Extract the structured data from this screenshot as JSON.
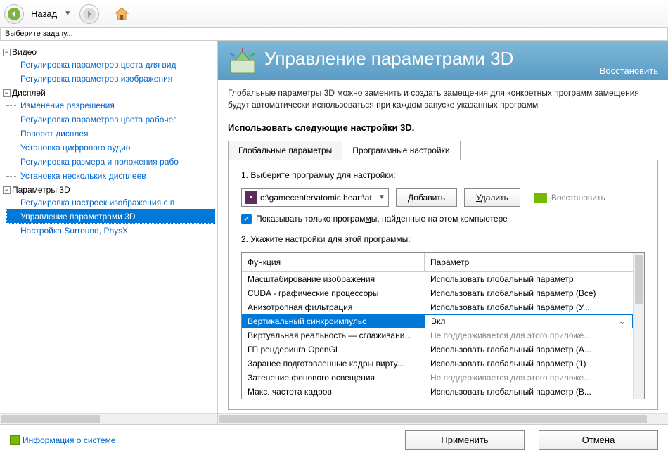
{
  "toolbar": {
    "back_label": "Назад"
  },
  "task_prompt": "Выберите задачу...",
  "tree": [
    {
      "title": "Видео",
      "items": [
        "Регулировка параметров цвета для вид",
        "Регулировка параметров изображения "
      ]
    },
    {
      "title": "Дисплей",
      "items": [
        "Изменение разрешения",
        "Регулировка параметров цвета рабочег",
        "Поворот дисплея",
        "Установка цифрового аудио",
        "Регулировка размера и положения рабо",
        "Установка нескольких дисплеев"
      ]
    },
    {
      "title": "Параметры 3D",
      "items": [
        "Регулировка настроек изображения с п",
        "Управление параметрами 3D",
        "Настройка Surround, PhysX"
      ]
    }
  ],
  "selected_item": "Управление параметрами 3D",
  "banner": {
    "title": "Управление параметрами 3D",
    "restore": "Восстановить"
  },
  "description": "Глобальные параметры 3D можно заменить и создать замещения для конкретных программ замещения будут автоматически использоваться при каждом запуске указанных программ",
  "section_title": "Использовать следующие настройки 3D.",
  "tabs": {
    "global": "Глобальные параметры",
    "program": "Программные настройки"
  },
  "program_tab": {
    "step1_label": "1. Выберите программу для настройки:",
    "selected_program": "c:\\gamecenter\\atomic heart\\at...",
    "add_btn": "Добавить",
    "remove_btn": "Удалить",
    "restore_btn": "Восстановить",
    "show_only_found_prefix": "Показывать только програм",
    "show_only_found_accel": "м",
    "show_only_found_suffix": "ы, найденные на этом компьютере",
    "step2_label": "2. Укажите настройки для этой программы:",
    "col_function": "Функция",
    "col_param": "Параметр",
    "rows": [
      {
        "f": "Масштабирование изображения",
        "p": "Использовать глобальный параметр",
        "gray": false
      },
      {
        "f": "CUDA - графические процессоры",
        "p": "Использовать глобальный параметр (Все)",
        "gray": false
      },
      {
        "f": "Анизотропная фильтрация",
        "p": "Использовать глобальный параметр (У...",
        "gray": false
      },
      {
        "f": "Вертикальный синхроимпульс",
        "p": "Вкл",
        "selected": true
      },
      {
        "f": "Виртуальная реальность — сглаживани...",
        "p": "Не поддерживается для этого приложе...",
        "gray": true
      },
      {
        "f": "ГП рендеринга OpenGL",
        "p": "Использовать глобальный параметр (А...",
        "gray": false
      },
      {
        "f": "Заранее подготовленные кадры вирту...",
        "p": "Использовать глобальный параметр (1)",
        "gray": false
      },
      {
        "f": "Затенение фонового освещения",
        "p": "Не поддерживается для этого приложе...",
        "gray": true
      },
      {
        "f": "Макс. частота кадров",
        "p": "Использовать глобальный параметр (В...",
        "gray": false
      }
    ]
  },
  "footer": {
    "sys_info": "Информация о системе",
    "apply": "Применить",
    "cancel": "Отмена"
  }
}
